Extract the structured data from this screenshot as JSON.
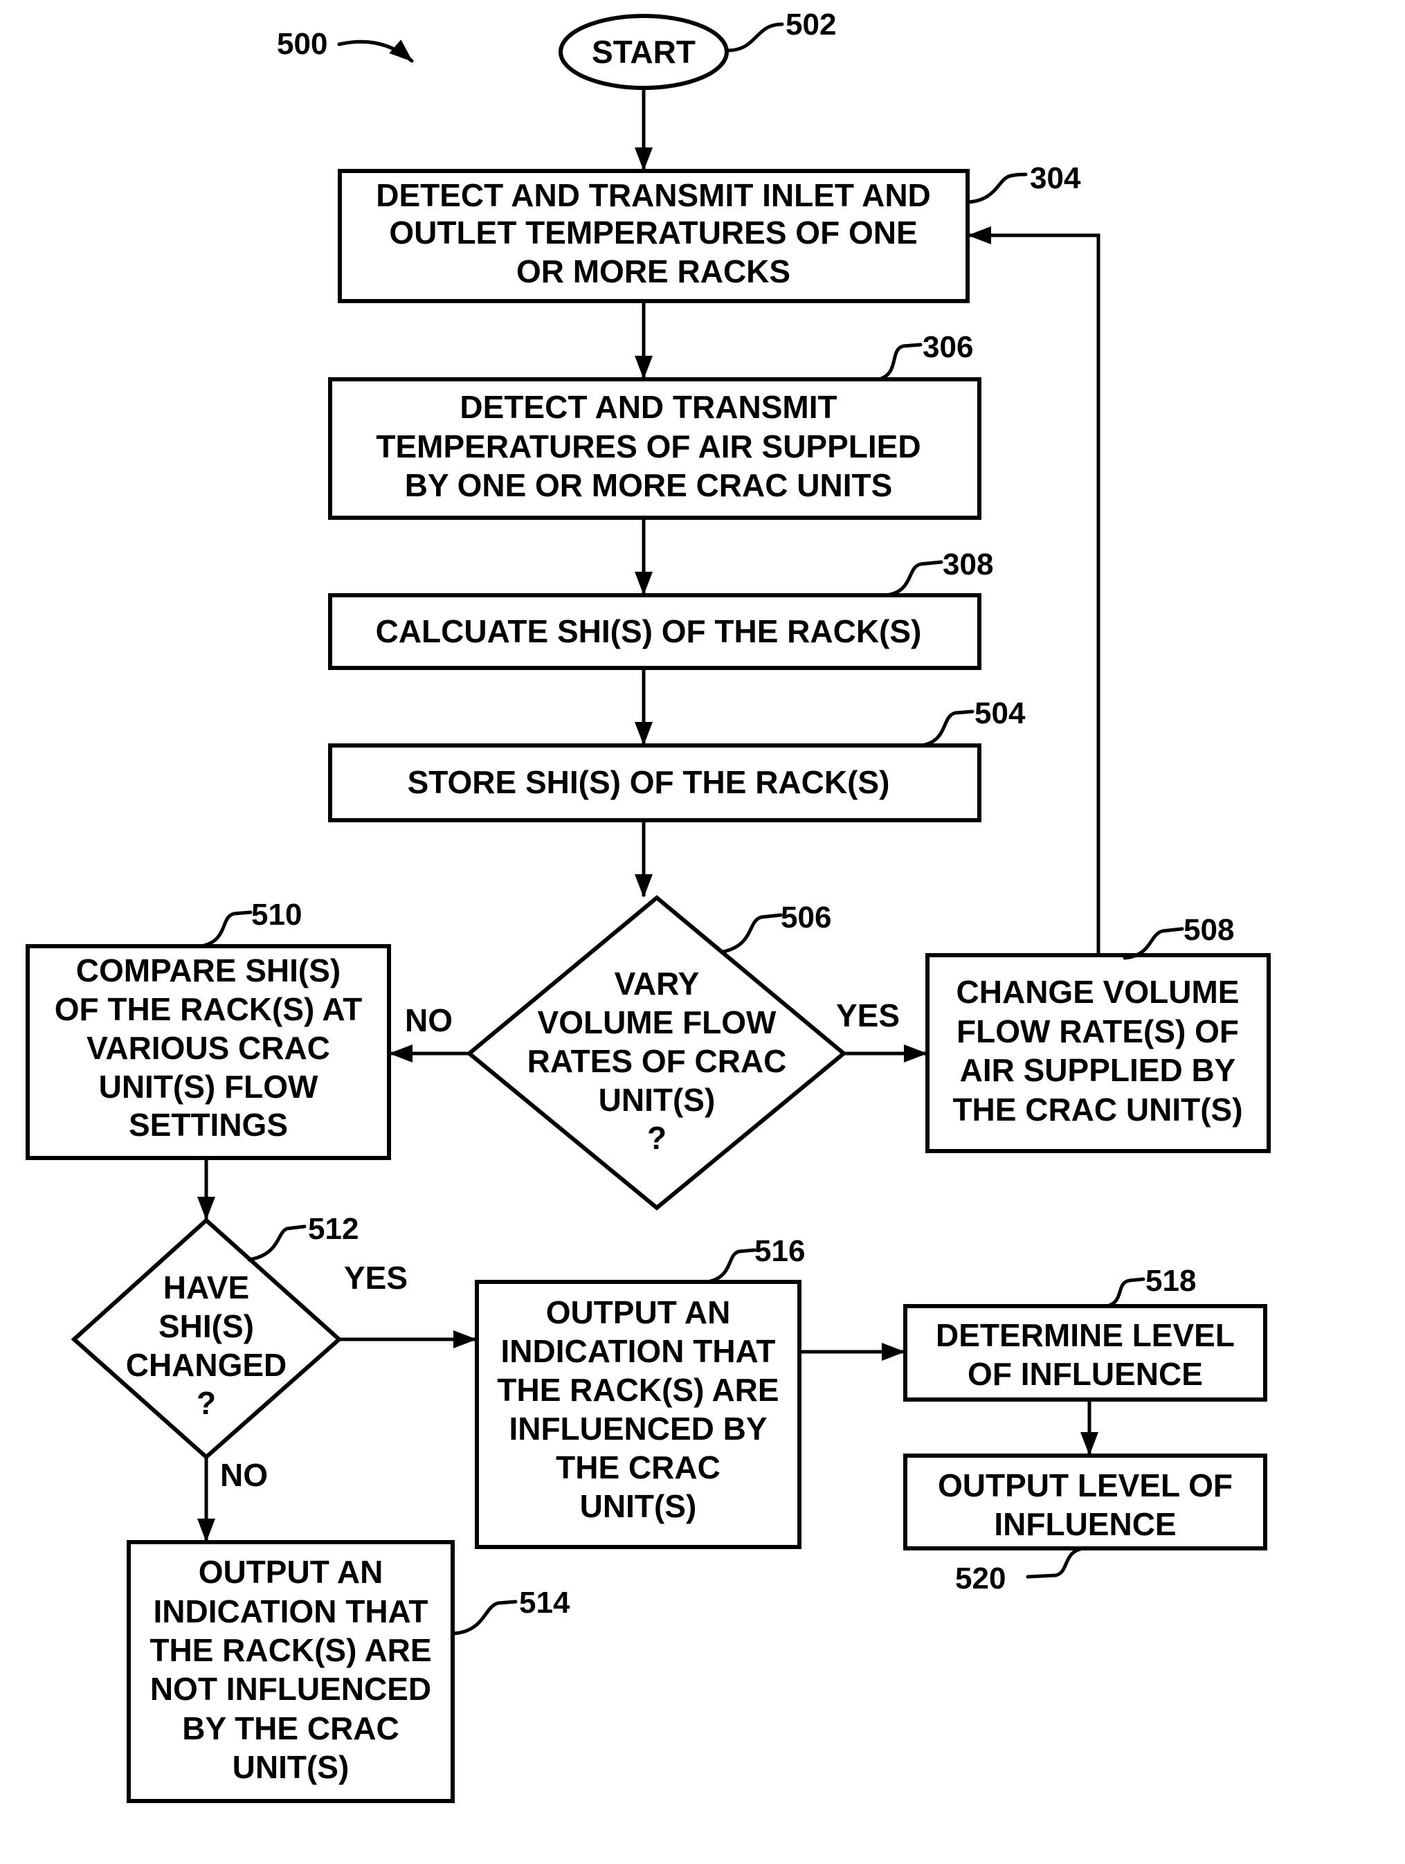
{
  "figure": {
    "figure_ref": "500",
    "nodes": {
      "n502": {
        "ref": "502",
        "shape": "oval",
        "lines": [
          "START"
        ]
      },
      "n304": {
        "ref": "304",
        "shape": "process",
        "lines": [
          "DETECT AND TRANSMIT INLET AND",
          "OUTLET TEMPERATURES OF ONE",
          "OR MORE RACKS"
        ]
      },
      "n306": {
        "ref": "306",
        "shape": "process",
        "lines": [
          "DETECT AND TRANSMIT",
          "TEMPERATURES OF AIR SUPPLIED",
          "BY ONE OR MORE CRAC UNITS"
        ]
      },
      "n308": {
        "ref": "308",
        "shape": "process",
        "lines": [
          "CALCUATE SHI(S) OF THE RACK(S)"
        ]
      },
      "n504": {
        "ref": "504",
        "shape": "process",
        "lines": [
          "STORE SHI(S) OF THE RACK(S)"
        ]
      },
      "n506": {
        "ref": "506",
        "shape": "decision",
        "lines": [
          "VARY",
          "VOLUME FLOW",
          "RATES OF CRAC",
          "UNIT(S)",
          "?"
        ]
      },
      "n508": {
        "ref": "508",
        "shape": "process",
        "lines": [
          "CHANGE VOLUME",
          "FLOW RATE(S) OF",
          "AIR SUPPLIED BY",
          "THE CRAC UNIT(S)"
        ]
      },
      "n510": {
        "ref": "510",
        "shape": "process",
        "lines": [
          "COMPARE SHI(S)",
          "OF THE RACK(S) AT",
          "VARIOUS CRAC",
          "UNIT(S) FLOW",
          "SETTINGS"
        ]
      },
      "n512": {
        "ref": "512",
        "shape": "decision",
        "lines": [
          "HAVE",
          "SHI(S)",
          "CHANGED",
          "?"
        ]
      },
      "n514": {
        "ref": "514",
        "shape": "process",
        "lines": [
          "OUTPUT AN",
          "INDICATION THAT",
          "THE RACK(S) ARE",
          "NOT INFLUENCED",
          "BY THE CRAC",
          "UNIT(S)"
        ]
      },
      "n516": {
        "ref": "516",
        "shape": "process",
        "lines": [
          "OUTPUT AN",
          "INDICATION THAT",
          "THE RACK(S) ARE",
          "INFLUENCED BY",
          "THE CRAC",
          "UNIT(S)"
        ]
      },
      "n518": {
        "ref": "518",
        "shape": "process",
        "lines": [
          "DETERMINE LEVEL",
          "OF INFLUENCE"
        ]
      },
      "n520": {
        "ref": "520",
        "shape": "process",
        "lines": [
          "OUTPUT LEVEL OF",
          "INFLUENCE"
        ]
      }
    },
    "edges": [
      {
        "from": "502",
        "to": "304",
        "label": ""
      },
      {
        "from": "304",
        "to": "306",
        "label": ""
      },
      {
        "from": "306",
        "to": "308",
        "label": ""
      },
      {
        "from": "308",
        "to": "504",
        "label": ""
      },
      {
        "from": "504",
        "to": "506",
        "label": ""
      },
      {
        "from": "506",
        "to": "508",
        "label": "YES"
      },
      {
        "from": "506",
        "to": "510",
        "label": "NO"
      },
      {
        "from": "508",
        "to": "304",
        "label": ""
      },
      {
        "from": "510",
        "to": "512",
        "label": ""
      },
      {
        "from": "512",
        "to": "516",
        "label": "YES"
      },
      {
        "from": "512",
        "to": "514",
        "label": "NO"
      },
      {
        "from": "516",
        "to": "518",
        "label": ""
      },
      {
        "from": "518",
        "to": "520",
        "label": ""
      }
    ],
    "branch_labels": {
      "d506_yes": "YES",
      "d506_no": "NO",
      "d512_yes": "YES",
      "d512_no": "NO"
    }
  }
}
